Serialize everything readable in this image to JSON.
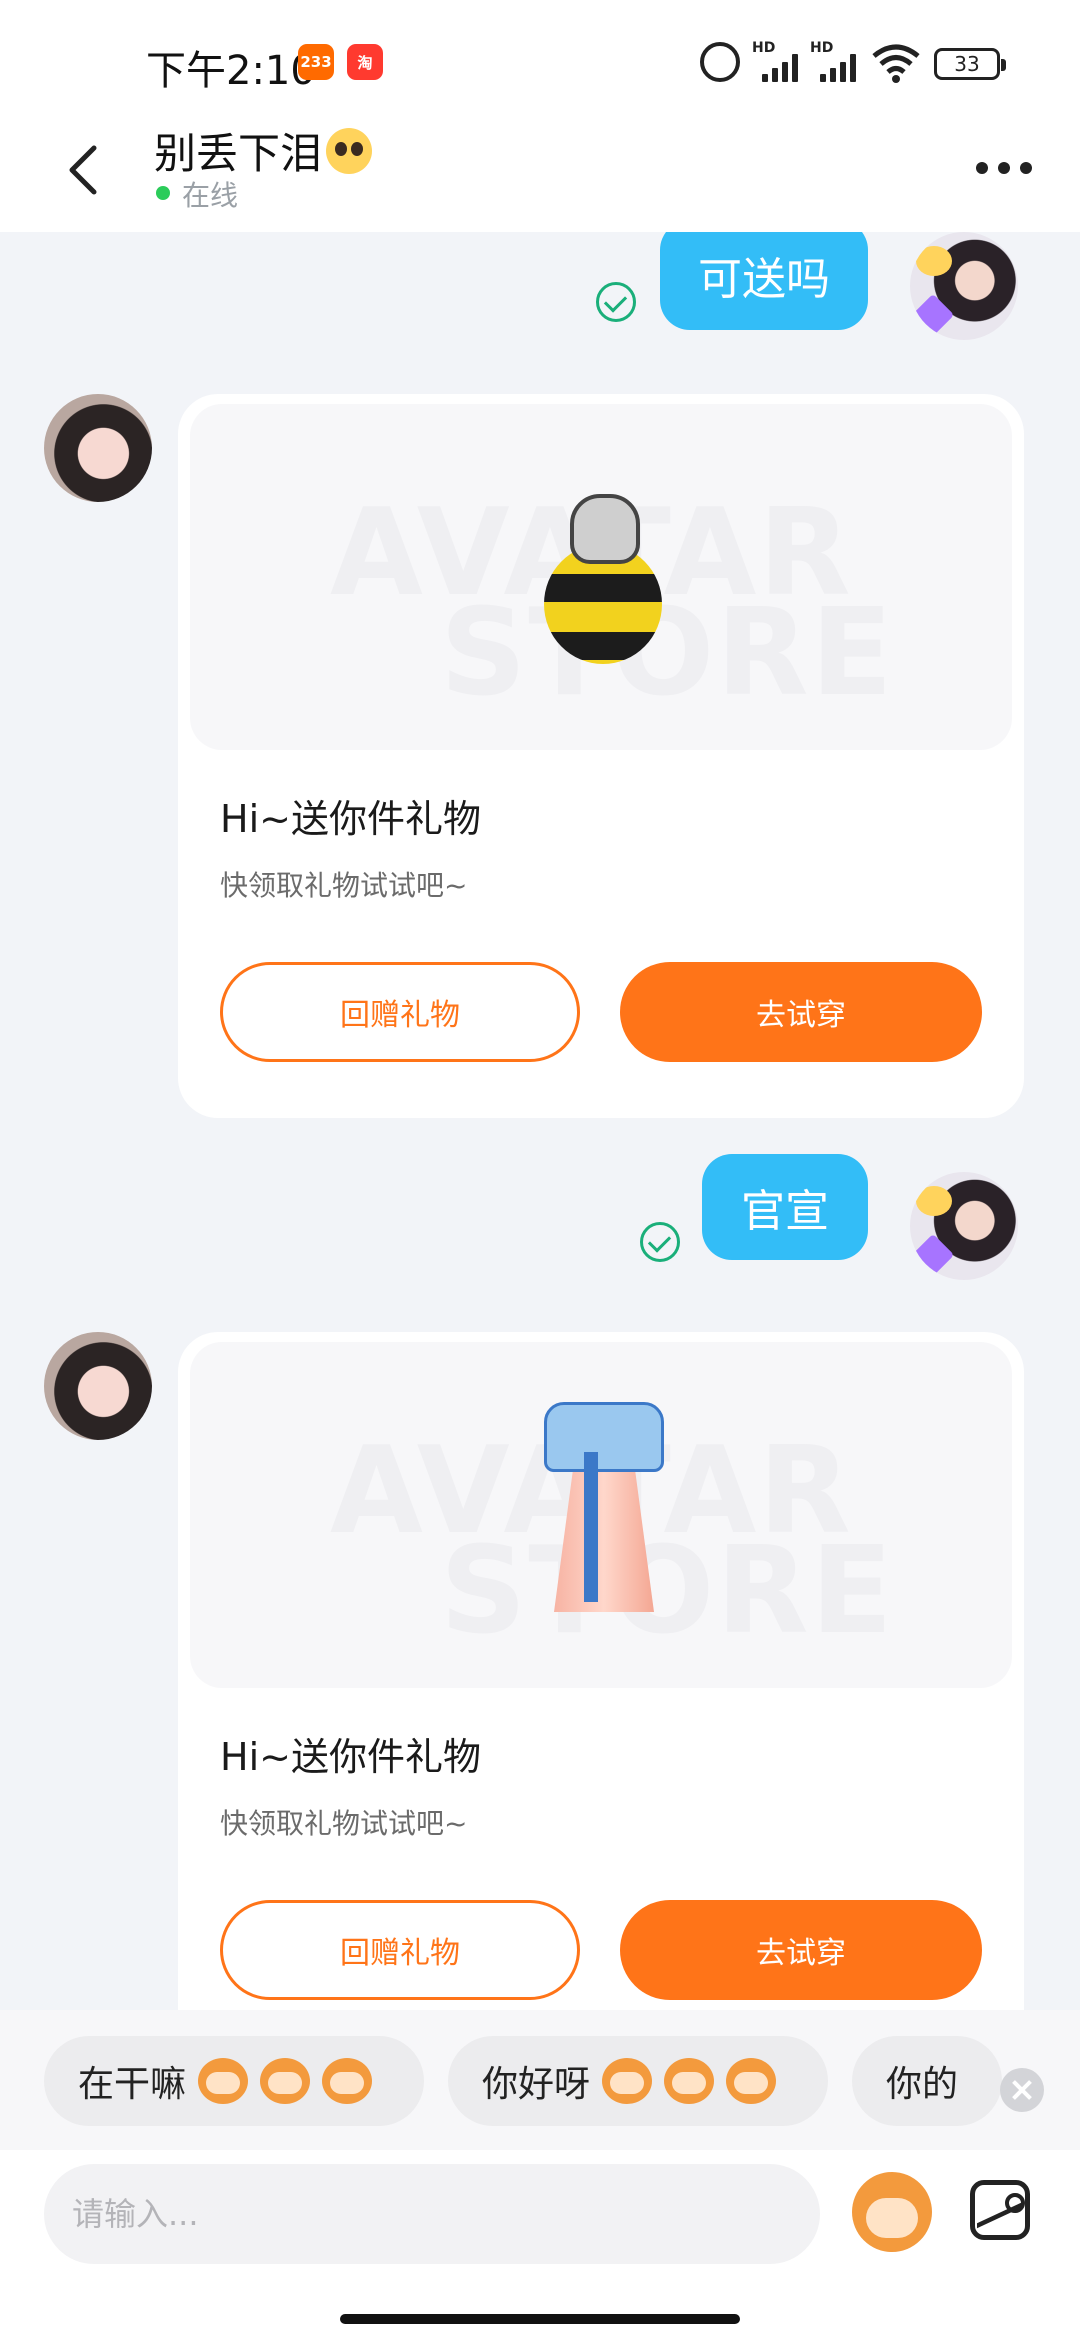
{
  "status_bar": {
    "time": "下午2:10",
    "app_badges": [
      "233",
      "淘"
    ],
    "battery": "33",
    "signal_labels": [
      "HD",
      "HD"
    ]
  },
  "header": {
    "title": "别丢下泪",
    "title_emoji": "pleading-face",
    "status": "在线"
  },
  "messages": [
    {
      "type": "text",
      "from": "me",
      "text": "可送吗",
      "delivered": true
    },
    {
      "type": "gift",
      "from": "them",
      "item": "bee-costume",
      "title": "Hi~送你件礼物",
      "subtitle": "快领取礼物试试吧~",
      "return_label": "回赠礼物",
      "try_label": "去试穿",
      "watermark": [
        "AVATAR",
        "STORE"
      ]
    },
    {
      "type": "text",
      "from": "me",
      "text": "官宣",
      "delivered": true
    },
    {
      "type": "gift",
      "from": "them",
      "item": "hanfu-dress",
      "title": "Hi~送你件礼物",
      "subtitle": "快领取礼物试试吧~",
      "return_label": "回赠礼物",
      "try_label": "去试穿",
      "watermark": [
        "AVATAR",
        "STORE"
      ]
    }
  ],
  "quick_replies": [
    {
      "text": "在干嘛"
    },
    {
      "text": "你好呀"
    },
    {
      "text": "你的"
    }
  ],
  "input": {
    "placeholder": "请输入..."
  },
  "colors": {
    "accent": "#ff7418",
    "bubble": "#33bdf7",
    "online": "#2bcc5a"
  }
}
